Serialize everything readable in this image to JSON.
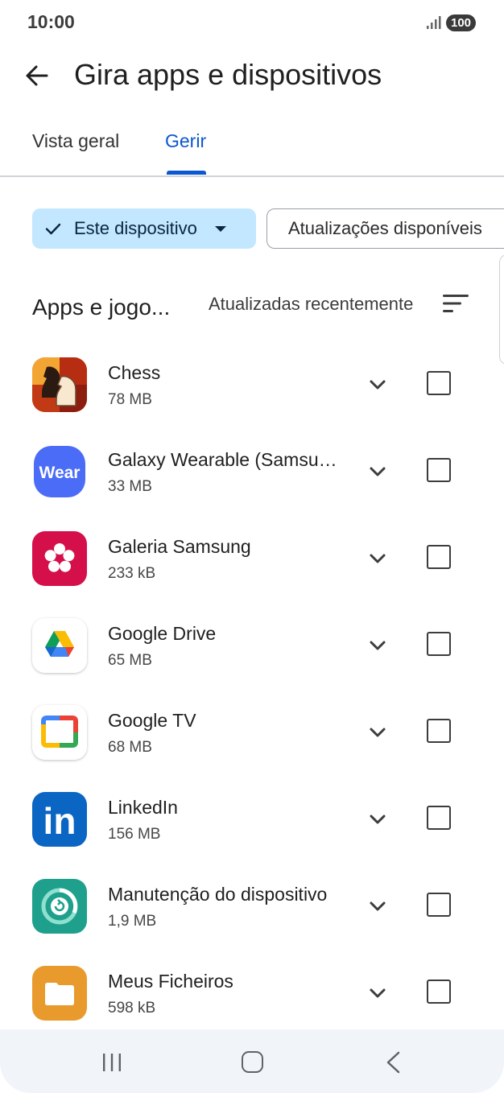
{
  "status_bar": {
    "time": "10:00",
    "battery": "100"
  },
  "header": {
    "title": "Gira apps e dispositivos",
    "back_icon": "back-arrow-icon"
  },
  "tabs": [
    {
      "label": "Vista geral",
      "selected": false
    },
    {
      "label": "Gerir",
      "selected": true
    }
  ],
  "filters": {
    "device_chip": "Este dispositivo",
    "updates_chip": "Atualizações disponíveis"
  },
  "section": {
    "title": "Apps e jogo...",
    "sort_label": "Atualizadas recentemente"
  },
  "apps": [
    {
      "name": "Chess",
      "size": "78 MB",
      "icon": "chess-knight-icon"
    },
    {
      "name": "Galaxy Wearable (Samsun...",
      "size": "33 MB",
      "icon": "wear-icon",
      "icon_text": "Wear"
    },
    {
      "name": "Galeria Samsung",
      "size": "233 kB",
      "icon": "flower-icon"
    },
    {
      "name": "Google Drive",
      "size": "65 MB",
      "icon": "google-drive-icon"
    },
    {
      "name": "Google TV",
      "size": "68 MB",
      "icon": "google-tv-icon"
    },
    {
      "name": "LinkedIn",
      "size": "156 MB",
      "icon": "linkedin-icon",
      "icon_text": "in"
    },
    {
      "name": "Manutenção do dispositivo",
      "size": "1,9 MB",
      "icon": "device-care-icon"
    },
    {
      "name": "Meus Ficheiros",
      "size": "598 kB",
      "icon": "folder-icon"
    }
  ],
  "colors": {
    "accent": "#0b57d0",
    "chip_selected_bg": "#c2e7ff",
    "nav_bar_bg": "#f1f4f9"
  }
}
